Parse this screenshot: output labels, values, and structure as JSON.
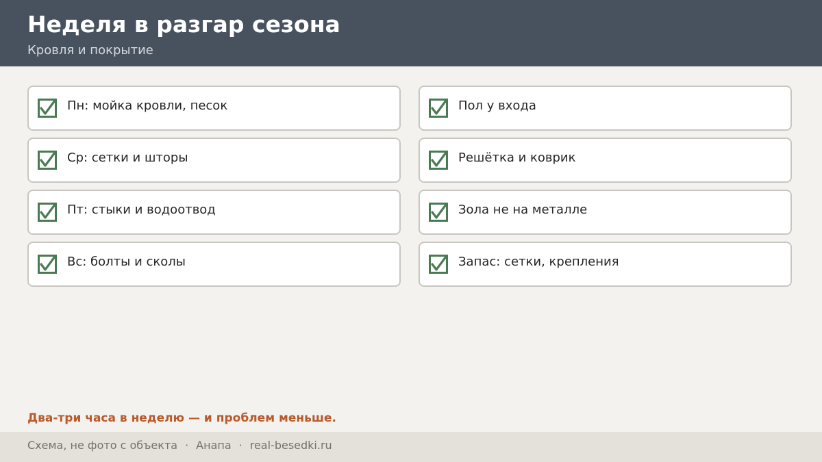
{
  "header": {
    "title": "Неделя в разгар сезона",
    "subtitle": "Кровля и покрытие"
  },
  "checklist": {
    "left": [
      {
        "label": "Пн: мойка кровли, песок",
        "checked": true
      },
      {
        "label": "Ср: сетки и шторы",
        "checked": true
      },
      {
        "label": "Пт: стыки и водоотвод",
        "checked": true
      },
      {
        "label": "Вс: болты и сколы",
        "checked": true
      }
    ],
    "right": [
      {
        "label": "Пол у входа",
        "checked": true
      },
      {
        "label": "Решётка и коврик",
        "checked": true
      },
      {
        "label": "Зола не на металле",
        "checked": true
      },
      {
        "label": "Запас: сетки, крепления",
        "checked": true
      }
    ]
  },
  "note": "Два-три часа в неделю — и проблем меньше.",
  "footer": {
    "caption": "Схема, не фото с объекта",
    "city": "Анапа",
    "site": "real-besedki.ru",
    "separator": "·"
  },
  "colors": {
    "header_bg": "#48525f",
    "check_green": "#4a7a52",
    "accent_orange": "#b85a2c",
    "page_bg": "#f4f2ee",
    "footer_bg": "#e4e1da"
  },
  "icons": {
    "checkbox": "checked-box-icon"
  }
}
